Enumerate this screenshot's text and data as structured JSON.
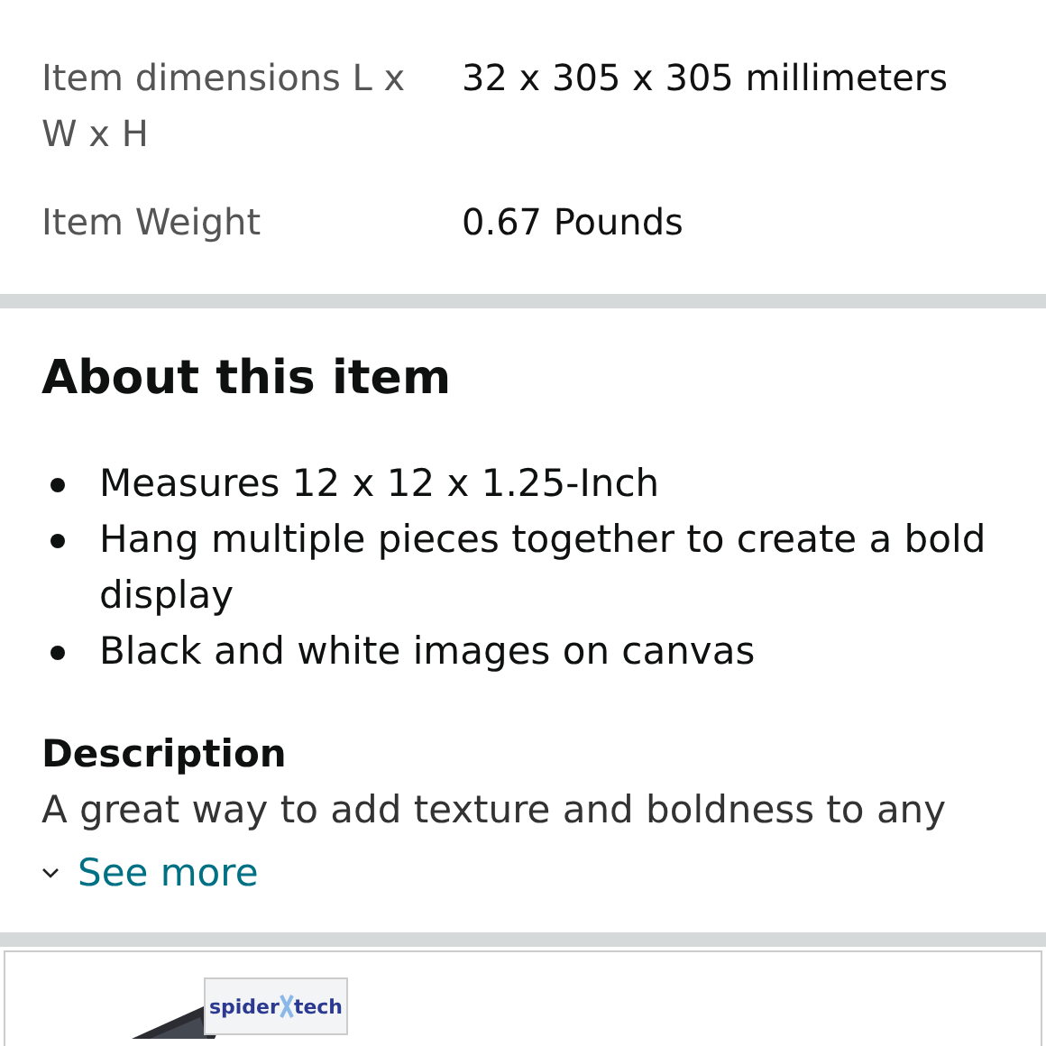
{
  "specs": [
    {
      "label": "Item dimensions L x W x H",
      "value": "32 x 305 x 305 millimeters"
    },
    {
      "label": "Item Weight",
      "value": "0.67 Pounds"
    }
  ],
  "about": {
    "title": "About this item",
    "bullets": [
      "Measures 12 x 12 x 1.25-Inch",
      "Hang multiple pieces together to create a bold display",
      "Black and white images on canvas"
    ]
  },
  "description": {
    "title": "Description",
    "text": "A great way to add texture and boldness to any",
    "see_more": "See more"
  },
  "ad": {
    "logo_left": "spider",
    "logo_right": "tech"
  }
}
